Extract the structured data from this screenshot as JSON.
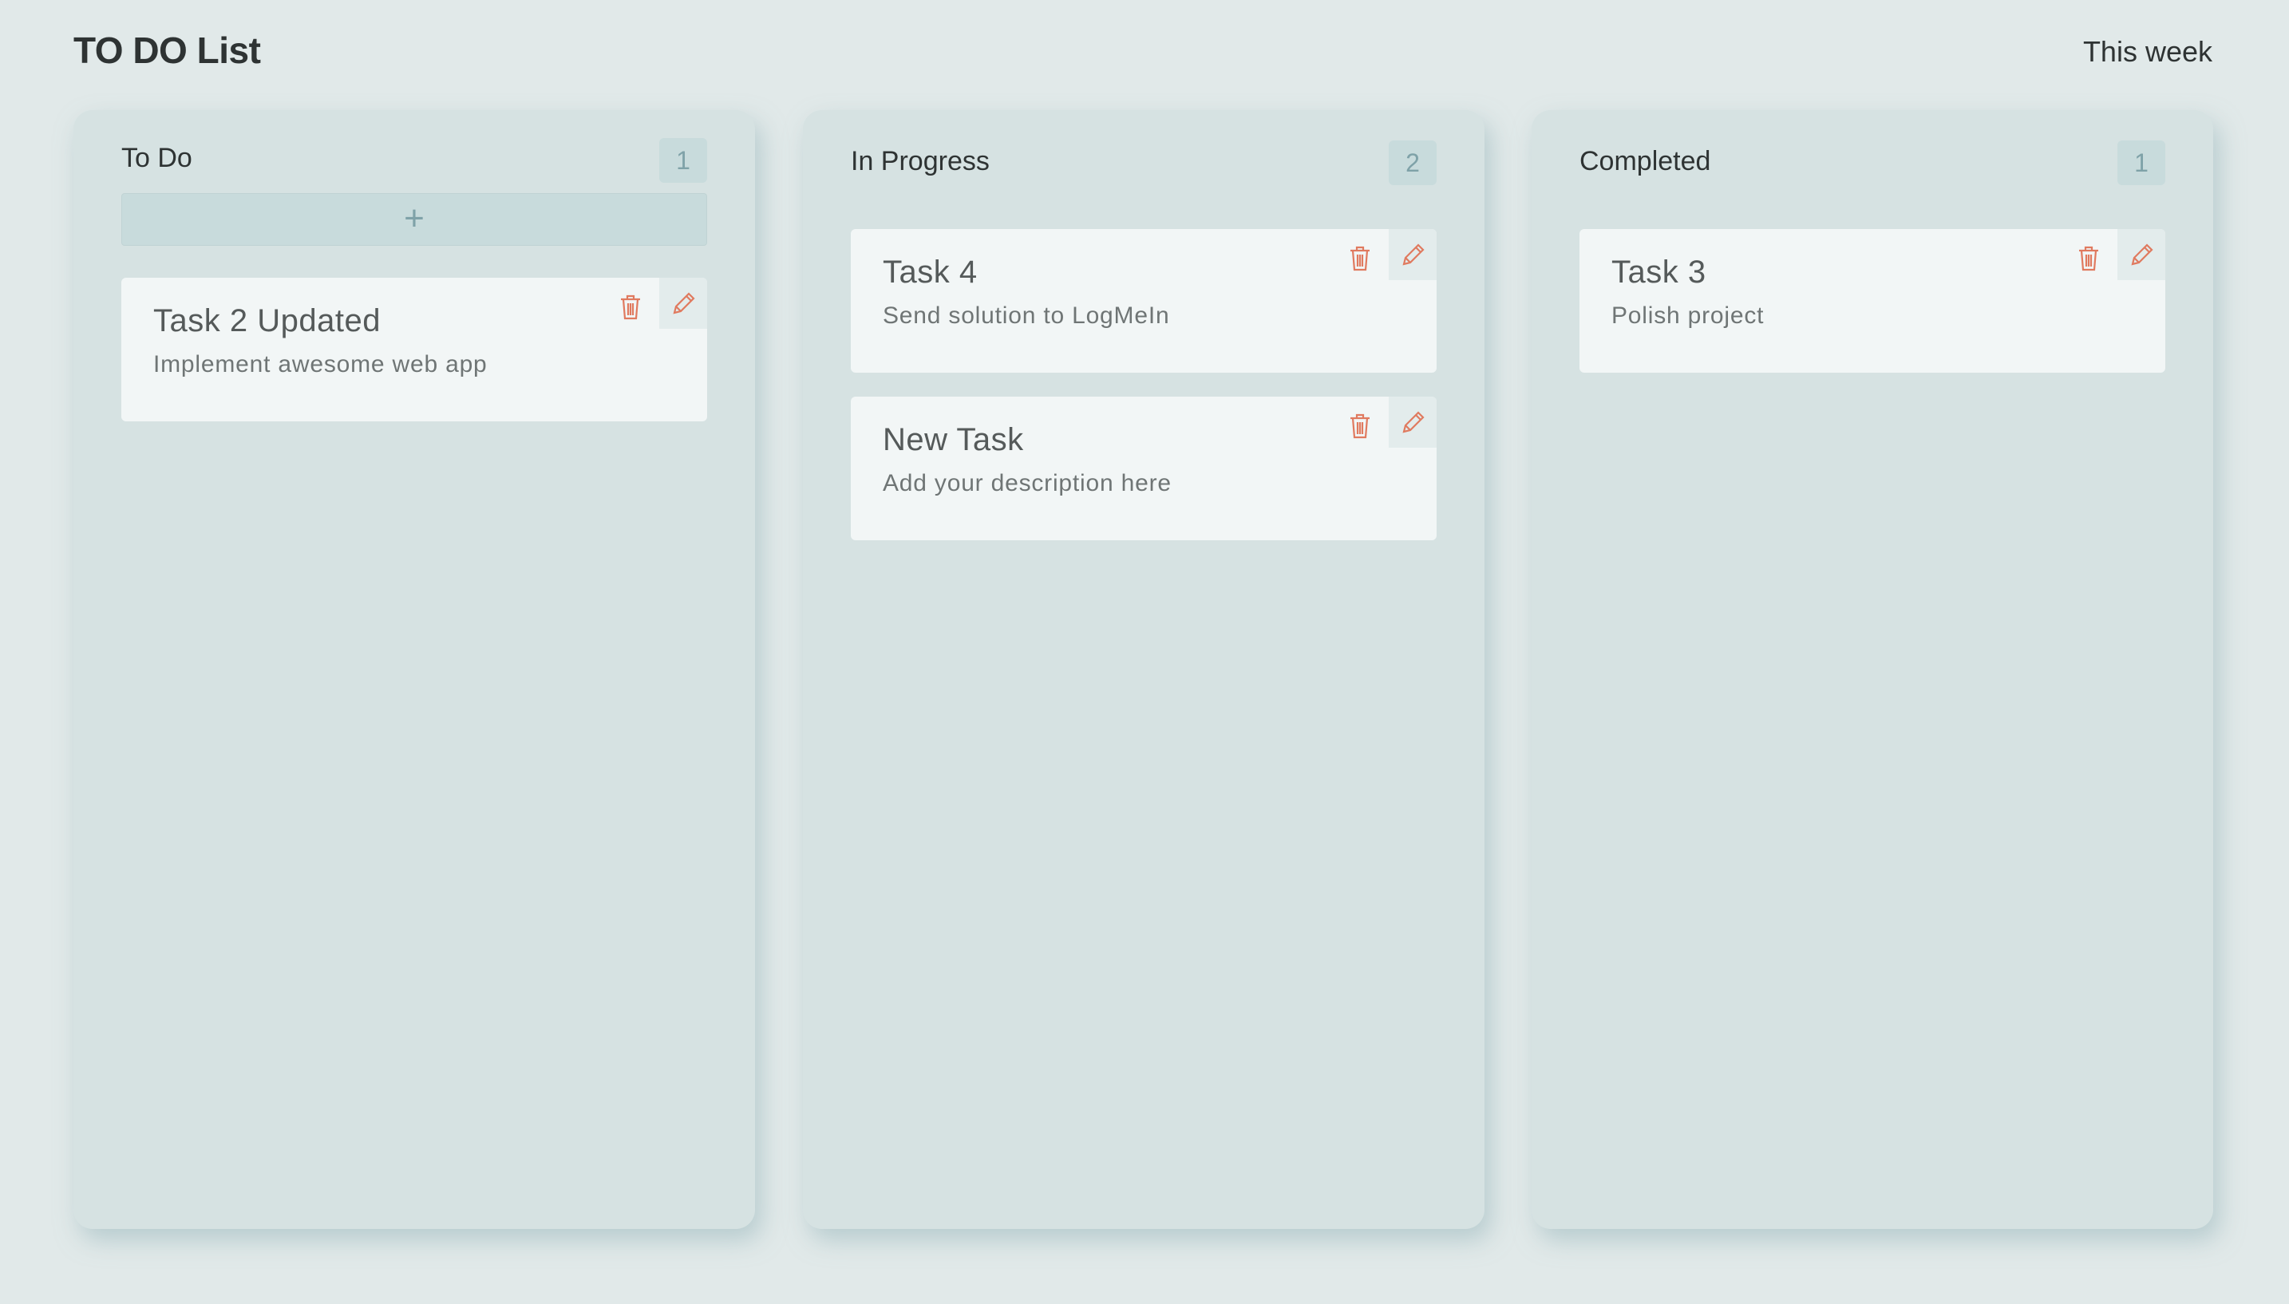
{
  "header": {
    "title": "TO DO List",
    "period": "This week"
  },
  "colors": {
    "background": "#e1e9e9",
    "column": "#d6e2e2",
    "card": "#f2f6f6",
    "badge": "#c8dbdc",
    "icon_accent": "#e07a5f"
  },
  "columns": [
    {
      "title": "To Do",
      "count": "1",
      "add_label": "+",
      "cards": [
        {
          "title": "Task 2 Updated",
          "description": "Implement awesome web app",
          "delete_icon": "trash-icon",
          "edit_icon": "pencil-icon"
        }
      ]
    },
    {
      "title": "In Progress",
      "count": "2",
      "cards": [
        {
          "title": "Task 4",
          "description": "Send solution to LogMeIn",
          "delete_icon": "trash-icon",
          "edit_icon": "pencil-icon"
        },
        {
          "title": "New Task",
          "description": "Add your description here",
          "delete_icon": "trash-icon",
          "edit_icon": "pencil-icon"
        }
      ]
    },
    {
      "title": "Completed",
      "count": "1",
      "cards": [
        {
          "title": "Task 3",
          "description": "Polish project",
          "delete_icon": "trash-icon",
          "edit_icon": "pencil-icon"
        }
      ]
    }
  ]
}
